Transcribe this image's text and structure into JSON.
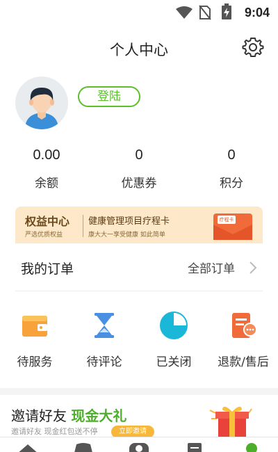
{
  "status_bar": {
    "time": "9:04",
    "icons": [
      "wifi-icon",
      "no-sim-icon",
      "battery-charging-icon"
    ]
  },
  "header": {
    "title": "个人中心",
    "settings_icon": "gear-icon"
  },
  "profile": {
    "login_label": "登陆"
  },
  "stats": [
    {
      "value": "0.00",
      "label": "余额"
    },
    {
      "value": "0",
      "label": "优惠券"
    },
    {
      "value": "0",
      "label": "积分"
    }
  ],
  "banner": {
    "title": "权益中心",
    "subtitle": "严选优质权益",
    "headline": "健康管理项目疗程卡",
    "tagline": "康大大一享受健康 如此简单",
    "card_label": "疗程卡"
  },
  "orders": {
    "title": "我的订单",
    "all_label": "全部订单",
    "items": [
      {
        "label": "待服务",
        "icon": "wallet-icon"
      },
      {
        "label": "待评论",
        "icon": "hourglass-icon"
      },
      {
        "label": "已关闭",
        "icon": "clock-circle-icon"
      },
      {
        "label": "退款/售后",
        "icon": "refund-icon"
      }
    ]
  },
  "invite": {
    "title": "邀请好友",
    "highlight": "现金大礼",
    "subtitle": "邀请好友 现金红包送不停",
    "button": "立即邀请"
  },
  "tabbar": {
    "icons": [
      "home-icon",
      "category-icon",
      "service-icon",
      "orders-icon",
      "profile-icon"
    ],
    "active_color": "#4cae2a"
  },
  "colors": {
    "accent": "#5bbf2c",
    "banner_bg": "#fde9c9",
    "orange": "#f7a23a",
    "red": "#f06a3a",
    "blue": "#4a90e2",
    "teal": "#1bb7d8"
  }
}
